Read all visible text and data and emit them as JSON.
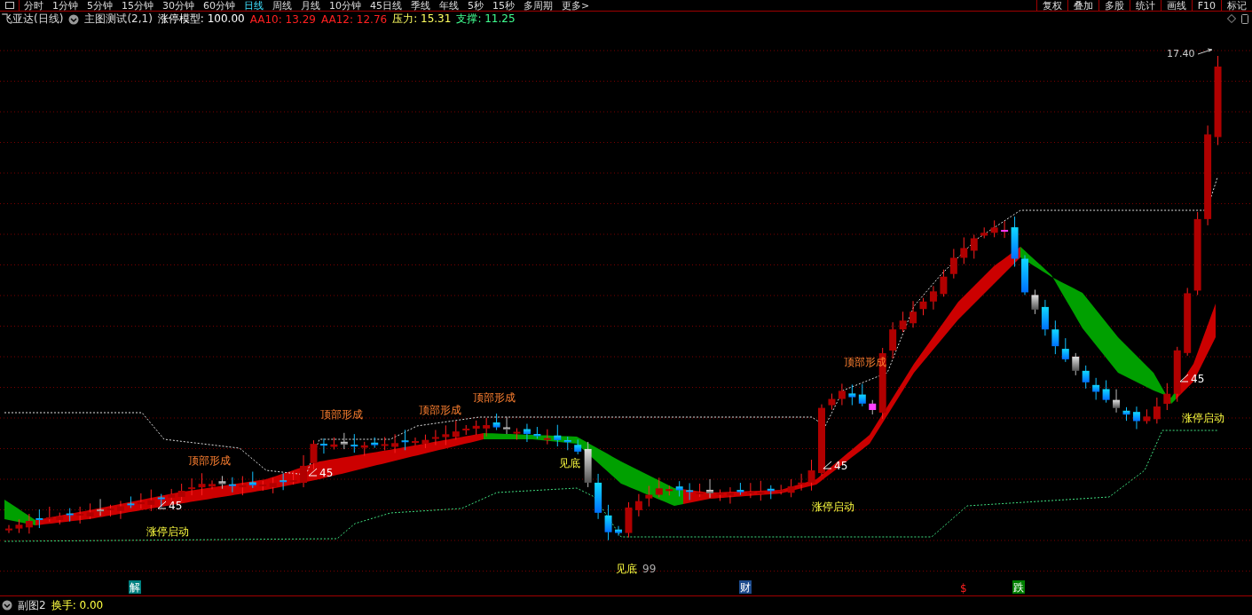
{
  "toolbar": {
    "periods": [
      {
        "label": "分时",
        "selected": false
      },
      {
        "label": "1分钟",
        "selected": false
      },
      {
        "label": "5分钟",
        "selected": false
      },
      {
        "label": "15分钟",
        "selected": false
      },
      {
        "label": "30分钟",
        "selected": false
      },
      {
        "label": "60分钟",
        "selected": false
      },
      {
        "label": "日线",
        "selected": true
      },
      {
        "label": "周线",
        "selected": false
      },
      {
        "label": "月线",
        "selected": false
      },
      {
        "label": "10分钟",
        "selected": false
      },
      {
        "label": "45日线",
        "selected": false
      },
      {
        "label": "季线",
        "selected": false
      },
      {
        "label": "年线",
        "selected": false
      },
      {
        "label": "5秒",
        "selected": false
      },
      {
        "label": "15秒",
        "selected": false
      },
      {
        "label": "多周期",
        "selected": false
      },
      {
        "label": "更多>",
        "selected": false
      }
    ],
    "tools": [
      "复权",
      "叠加",
      "多股",
      "统计",
      "画线",
      "F10",
      "标记"
    ]
  },
  "info": {
    "stock": "飞亚达(日线)",
    "indicator": "主图测试(2,1)",
    "items": [
      {
        "text": "涨停模型: 100.00",
        "color": "#ffffff"
      },
      {
        "text": "AA10: 13.29",
        "color": "#ff2020"
      },
      {
        "text": "AA12: 12.76",
        "color": "#ff2020"
      },
      {
        "text": "压力: 15.31",
        "color": "#ffff60"
      },
      {
        "text": "支撑: 11.25",
        "color": "#40ff90"
      }
    ]
  },
  "chart": {
    "price_label": "17.40",
    "annotations": [
      {
        "kind": "top",
        "text": "顶部形成"
      },
      {
        "kind": "top",
        "text": "顶部形成"
      },
      {
        "kind": "top",
        "text": "顶部形成"
      },
      {
        "kind": "top",
        "text": "顶部形成"
      },
      {
        "kind": "top",
        "text": "顶部形成"
      },
      {
        "kind": "start",
        "text": "涨停启动"
      },
      {
        "kind": "start",
        "text": "涨停启动"
      },
      {
        "kind": "start",
        "text": "涨停启动"
      },
      {
        "kind": "angle",
        "text": "45"
      },
      {
        "kind": "angle",
        "text": "45"
      },
      {
        "kind": "angle",
        "text": "45"
      },
      {
        "kind": "angle",
        "text": "45"
      },
      {
        "kind": "bottom",
        "text": "见底"
      },
      {
        "kind": "bottom",
        "text": "见底"
      },
      {
        "kind": "low",
        "text": "99"
      }
    ],
    "markers": [
      {
        "kind": "box",
        "text": "解",
        "color": "#008080"
      },
      {
        "kind": "box",
        "text": "财",
        "color": "#1c4a8c"
      },
      {
        "kind": "plain",
        "text": "$",
        "color": "#ff2020"
      },
      {
        "kind": "box",
        "text": "跌",
        "color": "#008000"
      }
    ]
  },
  "subchart": {
    "title": "副图2",
    "reading": "换手: 0.00"
  }
}
